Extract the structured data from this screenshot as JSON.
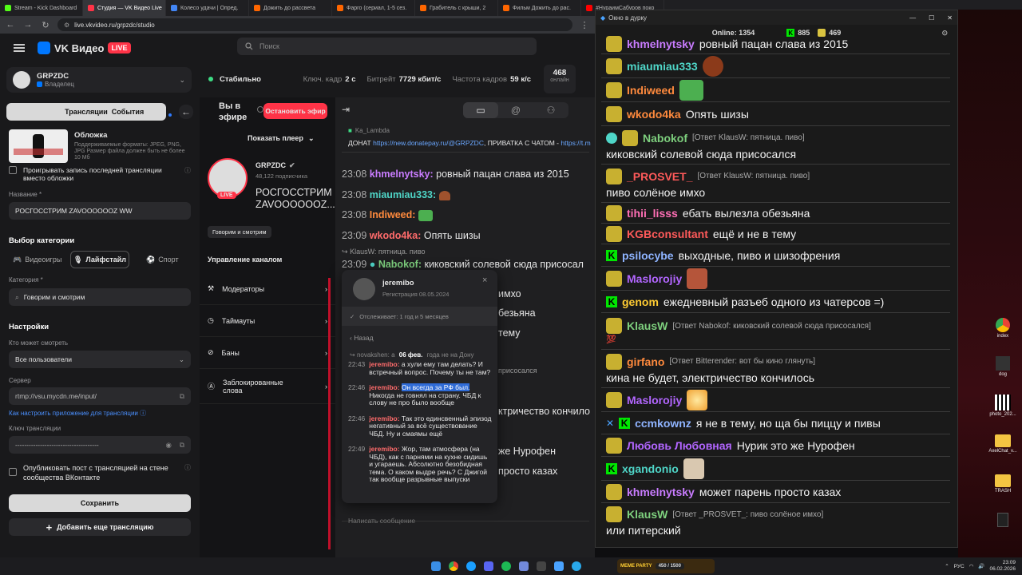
{
  "browser": {
    "tabs": [
      {
        "label": "Stream - Kick Dashboard",
        "color": "#53fc18"
      },
      {
        "label": "Студия — VK Видео Live",
        "color": "#ff3347",
        "active": true
      },
      {
        "label": "Колесо удачи | Опред.",
        "color": "#4285f4"
      },
      {
        "label": "Дожить до рассвета",
        "color": "#ff6600"
      },
      {
        "label": "Фарго (сериал, 1-5 сез.",
        "color": "#ff6600"
      },
      {
        "label": "Грабитель с крыши, 2",
        "color": "#ff6600"
      },
      {
        "label": "Фильм Дожить до рас.",
        "color": "#ff6600"
      },
      {
        "label": "#НураимСабуров поко",
        "color": "#ff0000"
      }
    ],
    "url": "live.vkvideo.ru/grpzdc/studio"
  },
  "header": {
    "logo": "VK Видео",
    "live": "LIVE",
    "search_placeholder": "Поиск"
  },
  "sidebar": {
    "channel_name": "GRPZDC",
    "channel_role": "Владелец",
    "tab_streams": "Трансляции",
    "tab_events": "События",
    "cover_title": "Обложка",
    "cover_hint": "Поддерживаемые форматы: JPEG, PNG, JPG Размер файла должен быть не более 10 Мб",
    "replay_label": "Проигрывать запись последней трансляции вместо обложки",
    "name_label": "Название *",
    "name_value": "РОСГОССТРИМ ZAVOOOOOOZ WW",
    "category_choice": "Выбор категории",
    "cat_games": "Видеоигры",
    "cat_lifestyle": "Лайфстайл",
    "cat_sport": "Спорт",
    "category_label": "Категория *",
    "category_value": "Говорим и смотрим",
    "settings_title": "Настройки",
    "who_label": "Кто может смотреть",
    "who_value": "Все пользователи",
    "server_label": "Сервер",
    "server_value": "rtmp://vsu.mycdn.me/input/",
    "howto_link": "Как настроить приложение для трансляции",
    "key_label": "Ключ трансляции",
    "key_value": "-------------------------------------",
    "post_label": "Опубликовать пост с трансляцией на стене сообщества ВКонтакте",
    "save": "Сохранить",
    "add_stream": "Добавить еще трансляцию"
  },
  "stats": {
    "status": "Стабильно",
    "keyframe_label": "Ключ. кадр",
    "keyframe": "2 с",
    "bitrate_label": "Битрейт",
    "bitrate": "7729 кбит/с",
    "fps_label": "Частота кадров",
    "fps": "59 к/с",
    "online": "468",
    "online_label": "онлайн"
  },
  "stream": {
    "on_air": "Вы в эфире",
    "stop": "Остановить эфир",
    "show_player": "Показать плеер",
    "channel": "GRPZDC",
    "subs": "48,122 подписчика",
    "title": "РОСГОССТРИМ ZAVOOOOOOZ...",
    "tag": "Говорим и смотрим",
    "live": "LIVE",
    "manage": "Управление каналом",
    "moderators": "Модераторы",
    "timeouts": "Таймауты",
    "bans": "Баны",
    "blocked": "Заблокированные слова"
  },
  "chat": {
    "pinned_user": "Ka_Lambda",
    "pinned_prefix": "ДОНАТ",
    "pinned_link": "https://new.donatepay.ru/@GRPZDC",
    "pinned_mid": ", ПРИВАТКА С ЧАТОМ -",
    "pinned_link2": "https://t.m",
    "lines": [
      {
        "time": "23:08",
        "user": "khmelnytsky:",
        "color": "#c97cff",
        "text": "ровный пацан слава из 2015"
      },
      {
        "time": "23:08",
        "user": "miaumiau333:",
        "color": "#4fd6c8",
        "text": ""
      },
      {
        "time": "23:08",
        "user": "Indiweed:",
        "color": "#ff8a3d",
        "text": ""
      },
      {
        "time": "23:09",
        "user": "wkodo4ka:",
        "color": "#ff6b6b",
        "text": "Опять шизы"
      },
      {
        "time": "23:09",
        "user": "Nabokof:",
        "color": "#7ed07e",
        "text": "киковский солевой сюда присосал"
      }
    ],
    "reply_hint": "KlausW: пятница. пиво",
    "bg_fragments": [
      "имхо",
      "безьяна",
      "тему",
      "присосался",
      "ктричество кончило",
      "же Нурофен",
      "просто казах"
    ],
    "input_placeholder": "Написать сообщение"
  },
  "popup": {
    "user": "jeremibo",
    "registered": "Регистрация 08.05.2024",
    "follow": "Отслеживает: 1 год и 5 месяцев",
    "back": "Назад",
    "ctx_user": "novakshen:",
    "ctx_text": "а",
    "date": "06 фев.",
    "ctx_tail": "года не на Дону",
    "messages": [
      {
        "time": "22:43",
        "user": "jeremibo:",
        "text": "а хули ему там делать? И встречный вопрос. Почему ты не там?"
      },
      {
        "time": "22:46",
        "user": "jeremibo:",
        "hl": "Он всегда за РФ был.",
        "text": "Никогда не говнял на страну. ЧБД к слову не про было вообще"
      },
      {
        "time": "22:46",
        "user": "jeremibo:",
        "text": "Так это единсвенный эпизод негативный за всё существование ЧБД. Ну и смаямы ещё"
      },
      {
        "time": "22:49",
        "user": "jeremibo:",
        "text": "Жор, там атмосфера (на ЧБД), как с парнями на кухне сидишь и угараешь. Абсолютно безобидная тема. О каком выдре речь? С Джигой так вообще разрывные выпуски"
      }
    ]
  },
  "overlay": {
    "title": "Окно в дурку",
    "online_label": "Online:",
    "online": "1354",
    "kick_count": "885",
    "vk_count": "469",
    "messages": [
      {
        "nick": "khmelnytsky",
        "color": "#c97cff",
        "text": "ровный пацан слава из 2015"
      },
      {
        "nick": "miaumiau333",
        "color": "#4fd6c8",
        "text": ""
      },
      {
        "nick": "Indiweed",
        "color": "#ff8a3d",
        "text": ""
      },
      {
        "nick": "wkodo4ka",
        "color": "#ff8a3d",
        "text": "Опять шизы"
      },
      {
        "nick": "Nabokof",
        "color": "#7ed07e",
        "reply": "[Ответ KlausW: пятница. пиво]",
        "text": "киковский солевой сюда присосался"
      },
      {
        "nick": "_PROSVET_",
        "color": "#ff5a5a",
        "reply": "[Ответ KlausW: пятница. пиво]",
        "text": "пиво солёное имхо"
      },
      {
        "nick": "tihii_lisss",
        "color": "#ff6fb5",
        "text": "ебать вылезла обезьяна"
      },
      {
        "nick": "KGBconsultant",
        "color": "#ff5a5a",
        "text": "ещё и не в тему"
      },
      {
        "nick": "psilocybe",
        "color": "#8fb4ff",
        "text": "выходные, пиво и шизофрения"
      },
      {
        "nick": "Maslorojiy",
        "color": "#b266ff",
        "text": ""
      },
      {
        "nick": "genom",
        "color": "#ffcc33",
        "text": "ежедневный разъеб одного из чатерсов =)"
      },
      {
        "nick": "KlausW",
        "color": "#7ed07e",
        "reply": "[Ответ Nabokof: киковский солевой сюда присосался]",
        "text": "💯"
      },
      {
        "nick": "girfano",
        "color": "#ff8a3d",
        "reply": "[Ответ Bitterender: вот бы кино глянуть]",
        "text": "кина не будет, электричество кончилось"
      },
      {
        "nick": "Maslorojiy",
        "color": "#b266ff",
        "text": ""
      },
      {
        "nick": "ccmkownz",
        "color": "#8fb4ff",
        "text": "я не в тему, но ща бы пиццу и пивы"
      },
      {
        "nick": "Любовь Любовная",
        "color": "#b266ff",
        "text": "Нурик это же Нурофен"
      },
      {
        "nick": "xgandonio",
        "color": "#4fd6c8",
        "text": ""
      },
      {
        "nick": "khmelnytsky",
        "color": "#c97cff",
        "text": "может парень просто казах"
      },
      {
        "nick": "KlausW",
        "color": "#7ed07e",
        "reply": "[Ответ _PROSVET_: пиво солёное имхо]",
        "text": "или питерский"
      }
    ]
  },
  "desktop": {
    "icons": [
      "index",
      "dog",
      "photo_202...",
      "AxelChat_v...",
      "TRASH",
      ""
    ]
  },
  "taskbar": {
    "lang": "РУС",
    "time": "23:09",
    "date": "06.02.2026",
    "widget": "MEME PARTY",
    "widget_progress": "450 / 1500"
  }
}
